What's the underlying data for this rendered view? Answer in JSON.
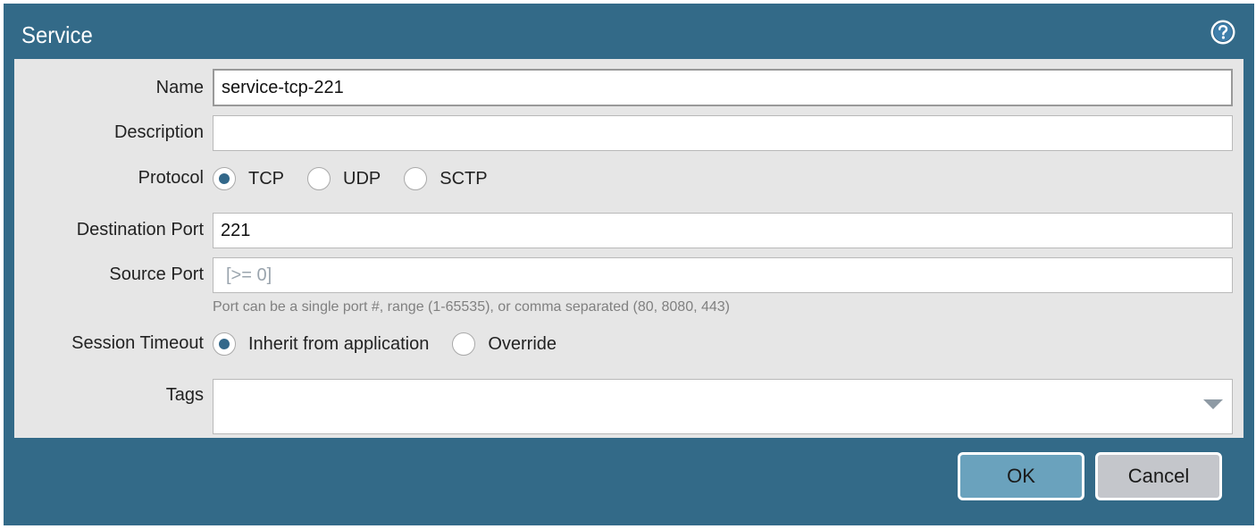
{
  "dialog": {
    "title": "Service",
    "help_icon": "help-circle-icon"
  },
  "form": {
    "name": {
      "label": "Name",
      "value": "service-tcp-221"
    },
    "description": {
      "label": "Description",
      "value": ""
    },
    "protocol": {
      "label": "Protocol",
      "options": [
        "TCP",
        "UDP",
        "SCTP"
      ],
      "selected": "TCP"
    },
    "destination_port": {
      "label": "Destination Port",
      "value": "221"
    },
    "source_port": {
      "label": "Source Port",
      "value": "",
      "placeholder": "[>= 0]",
      "hint": "Port can be a single port #, range (1-65535), or comma separated (80, 8080, 443)"
    },
    "session_timeout": {
      "label": "Session Timeout",
      "options": [
        "Inherit from application",
        "Override"
      ],
      "selected": "Inherit from application"
    },
    "tags": {
      "label": "Tags",
      "dropdown_icon": "chevron-down-icon"
    }
  },
  "buttons": {
    "ok_label": "OK",
    "cancel_label": "Cancel"
  },
  "colors": {
    "frame": "#336a88",
    "panel": "#e6e6e6",
    "ok_button": "#6aa2bd",
    "cancel_button": "#c4c6cb",
    "radio_selected": "#33688a"
  }
}
